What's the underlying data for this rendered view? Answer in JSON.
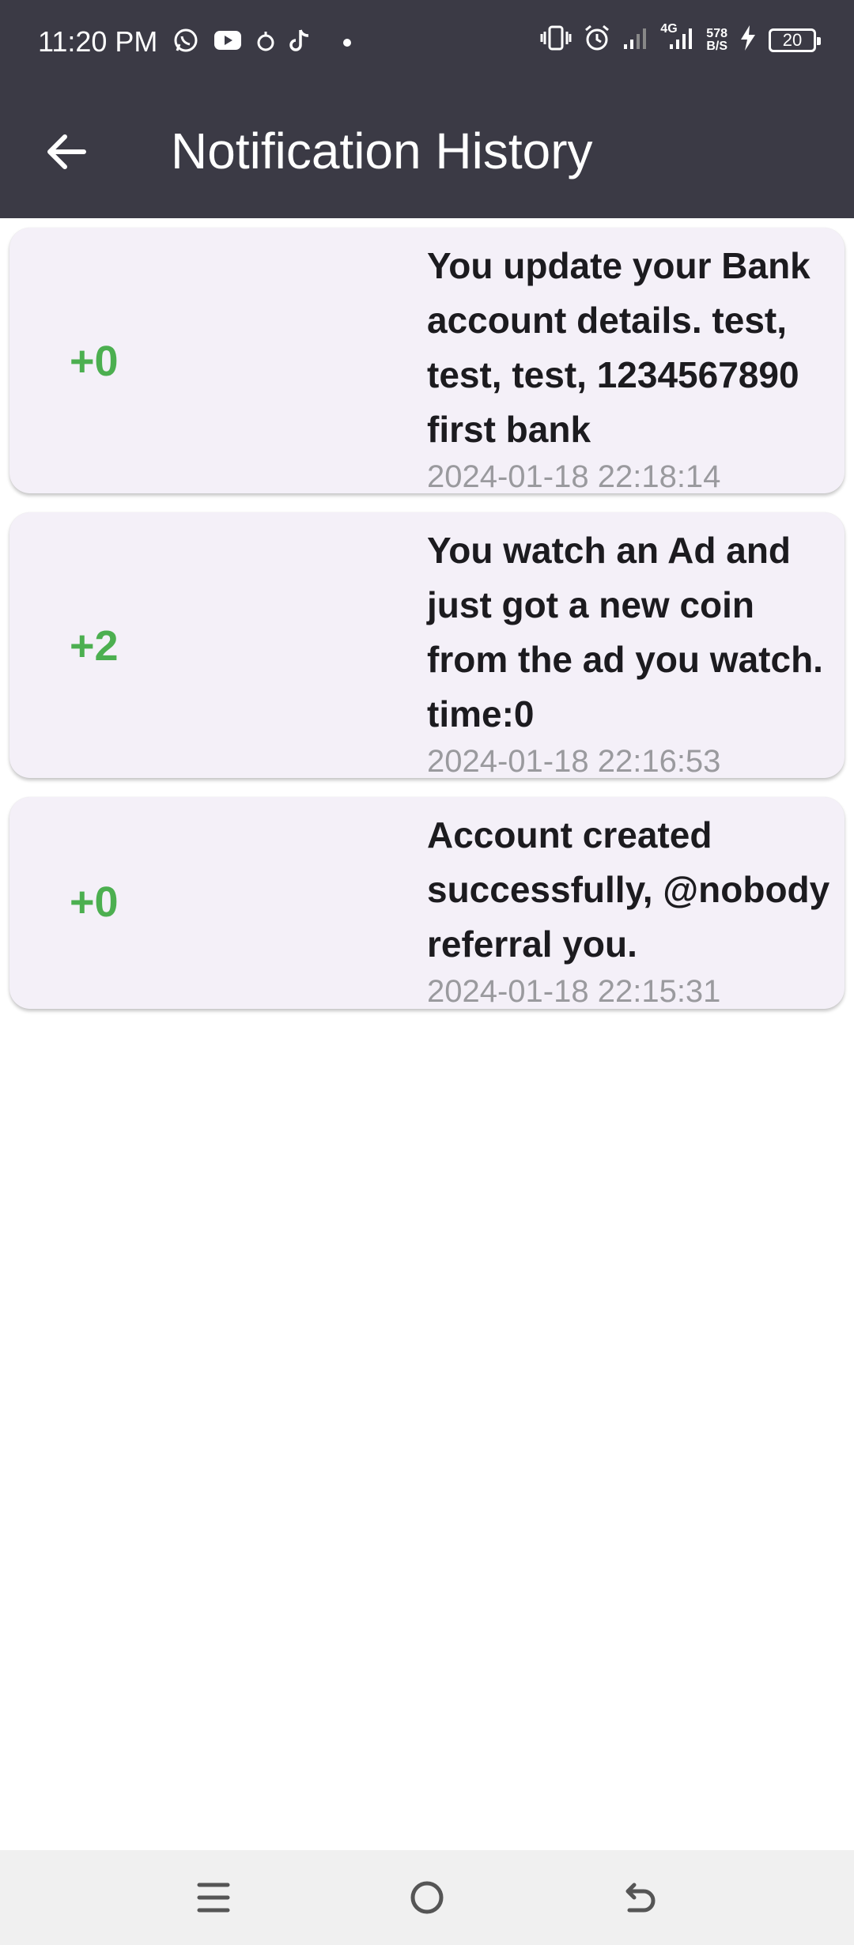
{
  "status_bar": {
    "time": "11:20 PM",
    "network_label": "4G",
    "speed_value": "578",
    "speed_unit": "B/S",
    "battery_level": "20",
    "left_icons": [
      "whatsapp-icon",
      "youtube-icon",
      "app-icon",
      "tiktok-icon",
      "dot-icon"
    ],
    "right_icons": [
      "vibrate-icon",
      "alarm-icon",
      "signal-icon",
      "signal-4g-icon",
      "charging-icon",
      "battery-icon"
    ]
  },
  "app_bar": {
    "title": "Notification History",
    "back_icon": "arrow-left-icon"
  },
  "colors": {
    "app_bar_bg": "#3b3a45",
    "card_bg": "#f4f0f8",
    "amount_green": "#4caf50",
    "time_gray": "#9a9a9e"
  },
  "notifications": [
    {
      "amount": "+0",
      "message": "You update your Bank account details. test, test, test, 1234567890 first bank",
      "time": "2024-01-18 22:18:14"
    },
    {
      "amount": "+2",
      "message": "You watch an Ad and just got a new coin from the ad you watch. time:0",
      "time": "2024-01-18 22:16:53"
    },
    {
      "amount": "+0",
      "message": "Account created successfully, @nobody referral you.",
      "time": "2024-01-18 22:15:31"
    }
  ],
  "nav_bar": {
    "icons": [
      "menu-icon",
      "home-icon",
      "back-icon"
    ]
  }
}
